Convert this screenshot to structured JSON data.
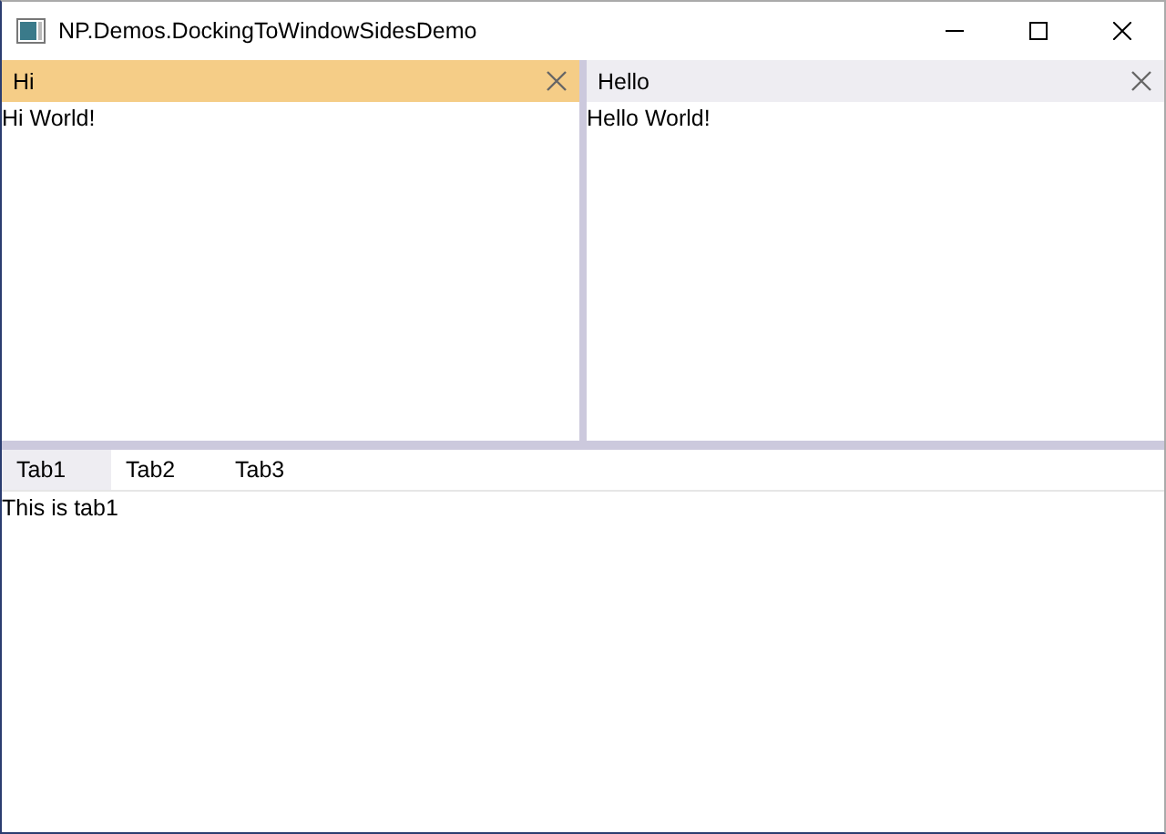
{
  "window": {
    "title": "NP.Demos.DockingToWindowSidesDemo"
  },
  "panes": [
    {
      "title": "Hi",
      "content": "Hi World!",
      "active": true
    },
    {
      "title": "Hello",
      "content": "Hello World!",
      "active": false
    }
  ],
  "tabs": [
    {
      "label": "Tab1",
      "selected": true
    },
    {
      "label": "Tab2",
      "selected": false
    },
    {
      "label": "Tab3",
      "selected": false
    }
  ],
  "tab_content": "This is tab1"
}
